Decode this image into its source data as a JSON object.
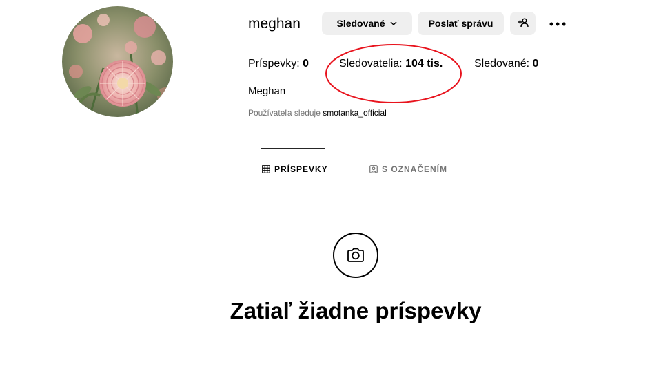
{
  "profile": {
    "username": "meghan",
    "full_name": "Meghan",
    "avatar": "flower-avatar"
  },
  "actions": {
    "following_label": "Sledované",
    "message_label": "Poslať správu",
    "add_user_icon": "add-user-icon",
    "more_icon": "more-dots-icon"
  },
  "stats": {
    "posts_label": "Príspevky:",
    "posts_value": "0",
    "followers_label": "Sledovatelia:",
    "followers_value": "104 tis.",
    "following_label": "Sledované:",
    "following_value": "0"
  },
  "followed_by": {
    "prefix": "Používateľa sleduje",
    "account": "smotanka_official"
  },
  "tabs": [
    {
      "label": "PRÍSPEVKY",
      "icon": "grid-icon",
      "active": true
    },
    {
      "label": "S OZNAČENÍM",
      "icon": "tagged-icon",
      "active": false
    }
  ],
  "empty_state": {
    "icon": "camera-icon",
    "title": "Zatiaľ žiadne príspevky"
  },
  "colors": {
    "button_bg": "#efefef",
    "secondary_text": "#737373",
    "divider": "#dbdbdb",
    "annotation": "#e8131d"
  }
}
